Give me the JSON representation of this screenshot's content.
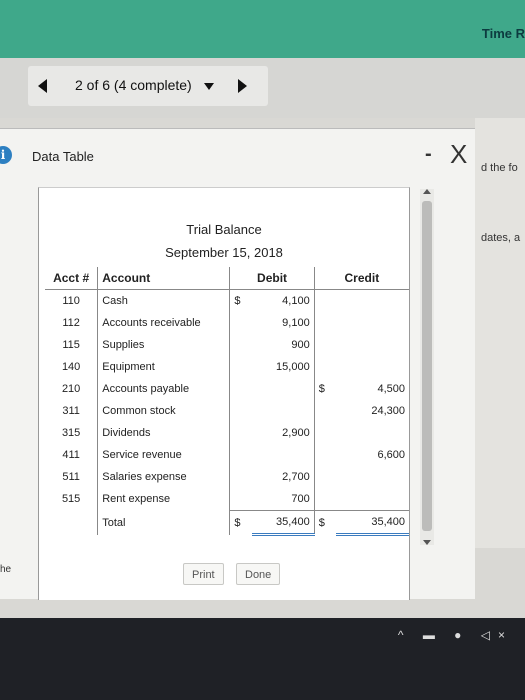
{
  "header": {
    "time_label": "Time R"
  },
  "nav": {
    "progress_label": "2 of 6 (4 complete)"
  },
  "side": {
    "text1": "d the fo",
    "text2": "dates, a"
  },
  "dialog": {
    "title": "Data Table",
    "minimize_label": "-",
    "close_label": "X"
  },
  "trial_balance": {
    "title": "Trial Balance",
    "date": "September 15, 2018",
    "headers": {
      "acct": "Acct #",
      "account": "Account",
      "debit": "Debit",
      "credit": "Credit"
    },
    "rows": [
      {
        "acct": "110",
        "account": "Cash",
        "dsym": "$",
        "debit": "4,100",
        "csym": "",
        "credit": ""
      },
      {
        "acct": "112",
        "account": "Accounts receivable",
        "dsym": "",
        "debit": "9,100",
        "csym": "",
        "credit": ""
      },
      {
        "acct": "115",
        "account": "Supplies",
        "dsym": "",
        "debit": "900",
        "csym": "",
        "credit": ""
      },
      {
        "acct": "140",
        "account": "Equipment",
        "dsym": "",
        "debit": "15,000",
        "csym": "",
        "credit": ""
      },
      {
        "acct": "210",
        "account": "Accounts payable",
        "dsym": "",
        "debit": "",
        "csym": "$",
        "credit": "4,500"
      },
      {
        "acct": "311",
        "account": "Common stock",
        "dsym": "",
        "debit": "",
        "csym": "",
        "credit": "24,300"
      },
      {
        "acct": "315",
        "account": "Dividends",
        "dsym": "",
        "debit": "2,900",
        "csym": "",
        "credit": ""
      },
      {
        "acct": "411",
        "account": "Service revenue",
        "dsym": "",
        "debit": "",
        "csym": "",
        "credit": "6,600"
      },
      {
        "acct": "511",
        "account": "Salaries expense",
        "dsym": "",
        "debit": "2,700",
        "csym": "",
        "credit": ""
      },
      {
        "acct": "515",
        "account": "Rent expense",
        "dsym": "",
        "debit": "700",
        "csym": "",
        "credit": ""
      }
    ],
    "total": {
      "label": "Total",
      "dsym": "$",
      "debit": "35,400",
      "csym": "$",
      "credit": "35,400"
    }
  },
  "buttons": {
    "print": "Print",
    "done": "Done"
  },
  "bottom_left": "he",
  "colors": {
    "topbar": "#3fa88a",
    "accent_blue": "#2d7fc1",
    "taskbar": "#1f2126"
  }
}
